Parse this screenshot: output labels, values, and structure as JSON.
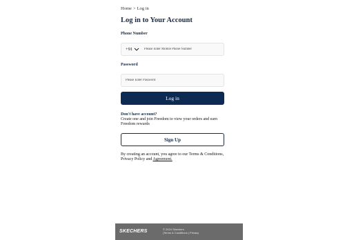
{
  "breadcrumb": {
    "home": "Home",
    "separator": ">",
    "current": "Log in"
  },
  "page_title": "Log in to Your Account",
  "phone": {
    "label": "Phone Number",
    "country_code": "+91",
    "placeholder": "Please Enter Mobile Phone Number"
  },
  "password": {
    "label": "Password",
    "placeholder": "Please Enter Password"
  },
  "login_button": "Log in",
  "signup_section": {
    "heading": "Don't have account?",
    "promo": "Create one and join Freedom to view your orders and earn Freedom rewards",
    "button": "Sign Up"
  },
  "terms": {
    "prefix": "By creating an account, you agree to our",
    "terms_link": "Terms & Conditions",
    "comma": ",",
    "privacy_link": "Privacy Policy",
    "and": "and",
    "agreement_link": "Agreement."
  },
  "footer": {
    "logo_text": "SKECHERS",
    "copyright": "© 2024 Skechers",
    "terms_link": "Terms & Conditions",
    "divider": "|",
    "privacy_link": "Privacy"
  },
  "colors": {
    "primary": "#0c2a52",
    "heading": "#1a2a44",
    "footer_bg": "#6b6b6b",
    "field_bg": "#f9f9f9"
  },
  "icons": {
    "country_dropdown": "chevron-down-icon"
  }
}
